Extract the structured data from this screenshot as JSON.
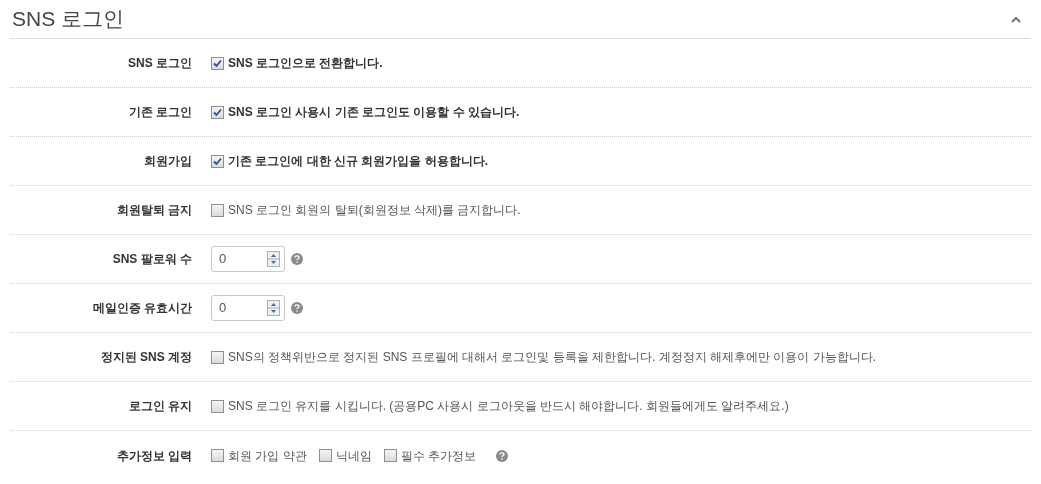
{
  "section": {
    "title": "SNS 로그인",
    "expanded": true
  },
  "rows": [
    {
      "kind": "checkbox",
      "label": "SNS 로그인",
      "text": "SNS 로그인으로 전환합니다.",
      "checked": true
    },
    {
      "kind": "checkbox",
      "label": "기존 로그인",
      "text": "SNS 로그인 사용시 기존 로그인도 이용할 수 있습니다.",
      "checked": true
    },
    {
      "kind": "checkbox",
      "label": "회원가입",
      "text": "기존 로그인에 대한 신규 회원가입을 허용합니다.",
      "checked": true
    },
    {
      "kind": "checkbox",
      "label": "회원탈퇴 금지",
      "text": "SNS 로그인 회원의 탈퇴(회원정보 삭제)를 금지합니다.",
      "checked": false
    },
    {
      "kind": "number",
      "label": "SNS 팔로워 수",
      "value": "0"
    },
    {
      "kind": "number",
      "label": "메일인증 유효시간",
      "value": "0"
    },
    {
      "kind": "checkbox",
      "label": "정지된 SNS 계정",
      "text": "SNS의 정책위반으로 정지된 SNS 프로필에 대해서 로그인및 등록을 제한합니다. 계정정지 해제후에만 이용이 가능합니다.",
      "checked": false
    },
    {
      "kind": "checkbox",
      "label": "로그인 유지",
      "text": "SNS 로그인 유지를 시킵니다. (공용PC 사용시 로그아웃을 반드시 해야합니다. 회원들에게도 알려주세요.)",
      "checked": false
    },
    {
      "kind": "options",
      "label": "추가정보 입력",
      "options": [
        {
          "text": "회원 가입 약관",
          "checked": false
        },
        {
          "text": "닉네임",
          "checked": false
        },
        {
          "text": "필수 추가정보",
          "checked": false
        }
      ]
    }
  ]
}
